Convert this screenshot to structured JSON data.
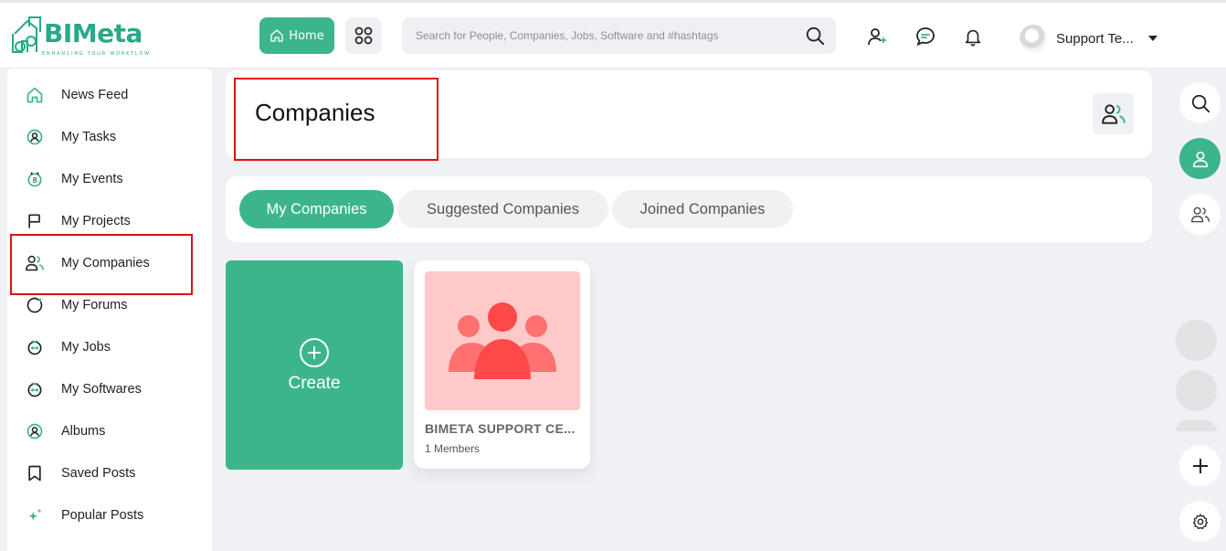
{
  "header": {
    "logo_text": "BIMeta",
    "logo_tagline": "ENHANCING YOUR WORKFLOW",
    "home_label": "Home",
    "search_placeholder": "Search for People, Companies, Jobs, Software and #hashtags",
    "user_name": "Support Te..."
  },
  "sidebar": {
    "items": [
      {
        "label": "News Feed",
        "icon": "home-icon"
      },
      {
        "label": "My Tasks",
        "icon": "tasks-icon"
      },
      {
        "label": "My Events",
        "icon": "calendar-icon"
      },
      {
        "label": "My Projects",
        "icon": "flag-icon"
      },
      {
        "label": "My Companies",
        "icon": "users-icon"
      },
      {
        "label": "My Forums",
        "icon": "forum-icon"
      },
      {
        "label": "My Jobs",
        "icon": "briefcase-icon"
      },
      {
        "label": "My Softwares",
        "icon": "software-icon"
      },
      {
        "label": "Albums",
        "icon": "album-icon"
      },
      {
        "label": "Saved Posts",
        "icon": "bookmark-icon"
      },
      {
        "label": "Popular Posts",
        "icon": "sparkle-icon"
      }
    ]
  },
  "main": {
    "title": "Companies",
    "tabs": [
      {
        "label": "My Companies",
        "active": true
      },
      {
        "label": "Suggested Companies",
        "active": false
      },
      {
        "label": "Joined Companies",
        "active": false
      }
    ],
    "create_label": "Create",
    "companies": [
      {
        "name": "BIMETA SUPPORT CE...",
        "members": "1 Members"
      }
    ]
  },
  "colors": {
    "accent": "#3db58b",
    "annotation": "#e01010",
    "company_thumb": "#ffc9c9",
    "company_icon": "#ff4d4d"
  }
}
